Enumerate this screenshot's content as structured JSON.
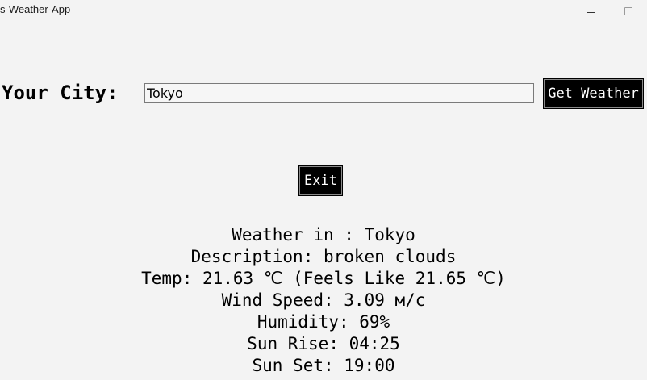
{
  "window": {
    "title": "s-Weather-App"
  },
  "form": {
    "city_label": "Your City:",
    "city_value": "Tokyo",
    "get_weather_label": "Get Weather",
    "exit_label": "Exit"
  },
  "weather": {
    "lines": [
      "Weather in : Tokyo",
      "Description: broken clouds",
      "Temp: 21.63 ℃ (Feels Like 21.65 ℃)",
      "Wind Speed: 3.09 м/с",
      "Humidity: 69%",
      "Sun Rise: 04:25",
      "Sun Set: 19:00"
    ]
  }
}
